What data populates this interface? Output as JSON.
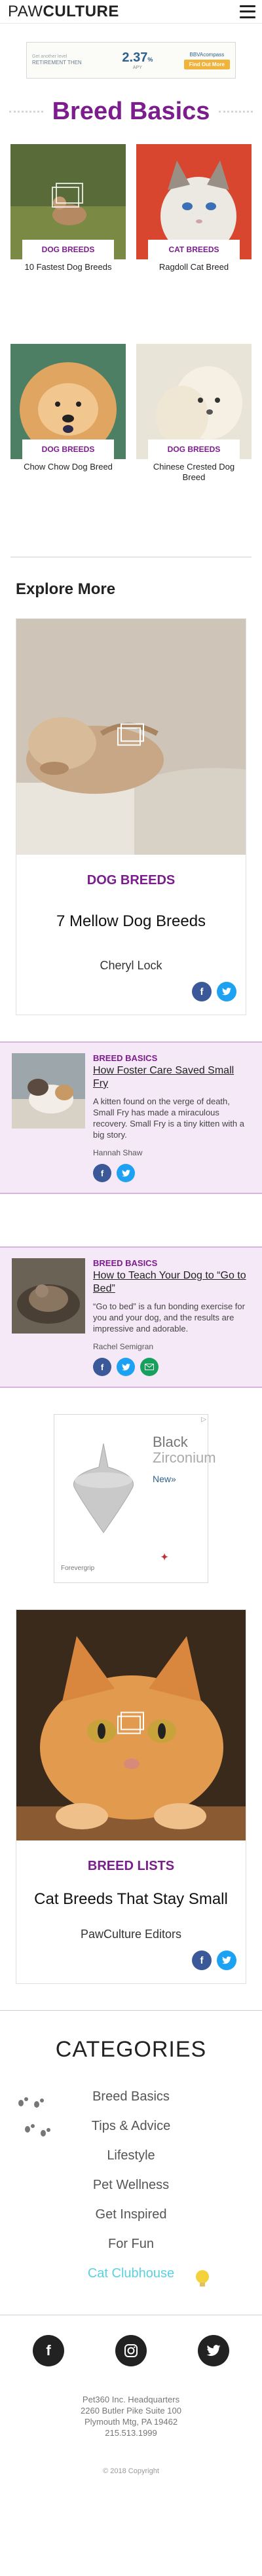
{
  "header": {
    "logo_light": "PAW",
    "logo_bold": "CULTURE"
  },
  "top_ad": {
    "headline": "Get another level",
    "tagline": "RETIREMENT THEN",
    "rate": "2.37",
    "rate_unit": "%",
    "apy": "APY",
    "brand": "BBVAcompass",
    "cta": "Find Out More"
  },
  "page_title": "Breed Basics",
  "grid": [
    {
      "category": "Dog Breeds",
      "title": "10 Fastest Dog Breeds"
    },
    {
      "category": "Cat Breeds",
      "title": "Ragdoll Cat Breed"
    },
    {
      "category": "Dog Breeds",
      "title": "Chow Chow Dog Breed"
    },
    {
      "category": "Dog Breeds",
      "title": "Chinese Crested Dog Breed"
    }
  ],
  "explore_heading": "Explore More",
  "big_card_1": {
    "category": "Dog Breeds",
    "title": "7 Mellow Dog Breeds",
    "author": "Cheryl Lock"
  },
  "small_1": {
    "category": "Breed Basics",
    "title": "How Foster Care Saved Small Fry",
    "description": "A kitten found on the verge of death, Small Fry has made a miraculous recovery. Small Fry is a tiny kitten with a big story.",
    "author": "Hannah Shaw"
  },
  "small_2": {
    "category": "Breed Basics",
    "title": "How to Teach Your Dog to “Go to Bed”",
    "description": "“Go to bed” is a fun bonding exercise for you and your dog, and the results are impressive and adorable.",
    "author": "Rachel Semigran"
  },
  "mid_ad": {
    "line1": "Black",
    "line2": "Zirconium",
    "new": "New»",
    "brand": "Forevergrip"
  },
  "big_card_2": {
    "category": "Breed Lists",
    "title": "Cat Breeds That Stay Small",
    "author": "PawCulture Editors"
  },
  "categories": {
    "heading": "CATEGORIES",
    "items": [
      "Breed Basics",
      "Tips & Advice",
      "Lifestyle",
      "Pet Wellness",
      "Get Inspired",
      "For Fun",
      "Cat Clubhouse"
    ]
  },
  "footer": {
    "address1": "Pet360 Inc. Headquarters",
    "address2": "2260 Butler Pike Suite 100",
    "address3": "Plymouth Mtg, PA 19462",
    "phone": "215.513.1999",
    "copyright": "© 2018 Copyright"
  },
  "icons": {
    "share_facebook": "facebook-icon",
    "share_twitter": "twitter-icon",
    "share_email": "email-icon",
    "social_instagram": "instagram-icon"
  },
  "colors": {
    "accent": "#7b1d8c",
    "facebook": "#3b5998",
    "twitter": "#1da1f2",
    "email": "#17a05d",
    "highlight": "#5ad1e3",
    "article_bg": "#f5e9f7"
  }
}
